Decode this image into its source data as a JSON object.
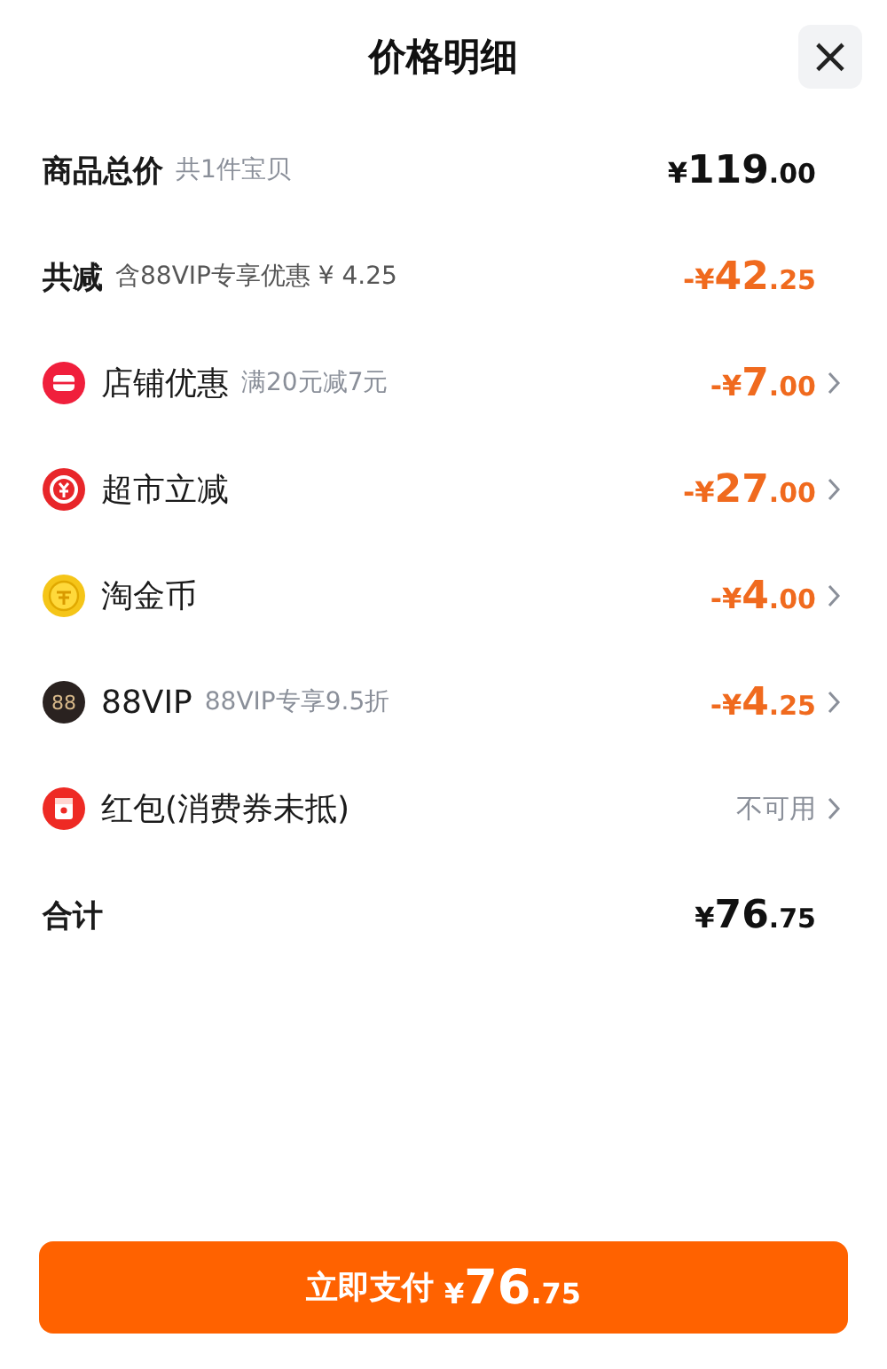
{
  "header": {
    "title": "价格明细",
    "close": "×"
  },
  "rows": [
    {
      "kind": "subtotal",
      "label": "商品总价",
      "note": "共1件宝贝",
      "amount": {
        "sign": "¥",
        "integer": "119",
        "decimal": ".00"
      }
    },
    {
      "kind": "reduction",
      "label": "共减",
      "note": "含88VIP专享优惠 ¥ 4.25",
      "amount": {
        "sign": "-¥",
        "integer": "42",
        "decimal": ".25"
      }
    },
    {
      "kind": "shop",
      "label": "店铺优惠",
      "note": "满20元减7元",
      "amount": {
        "sign": "-¥",
        "integer": "7",
        "decimal": ".00"
      },
      "link": true
    },
    {
      "kind": "market",
      "label": "超市立减",
      "amount": {
        "sign": "-¥",
        "integer": "27",
        "decimal": ".00"
      },
      "link": true
    },
    {
      "kind": "coin",
      "label": "淘金币",
      "amount": {
        "sign": "-¥",
        "integer": "4",
        "decimal": ".00"
      },
      "link": true
    },
    {
      "kind": "vip",
      "icon_text": "88",
      "label": "88VIP",
      "note": "88VIP专享9.5折",
      "amount": {
        "sign": "-¥",
        "integer": "4",
        "decimal": ".25"
      },
      "link": true
    },
    {
      "kind": "packet",
      "label": "红包(消费券未抵)",
      "status": "不可用",
      "link": true
    },
    {
      "kind": "total",
      "label": "合计",
      "amount": {
        "sign": "¥",
        "integer": "76",
        "decimal": ".75"
      }
    }
  ],
  "pay_button": {
    "label": "立即支付",
    "amount": {
      "sign": "¥",
      "integer": "76",
      "decimal": ".75"
    }
  }
}
